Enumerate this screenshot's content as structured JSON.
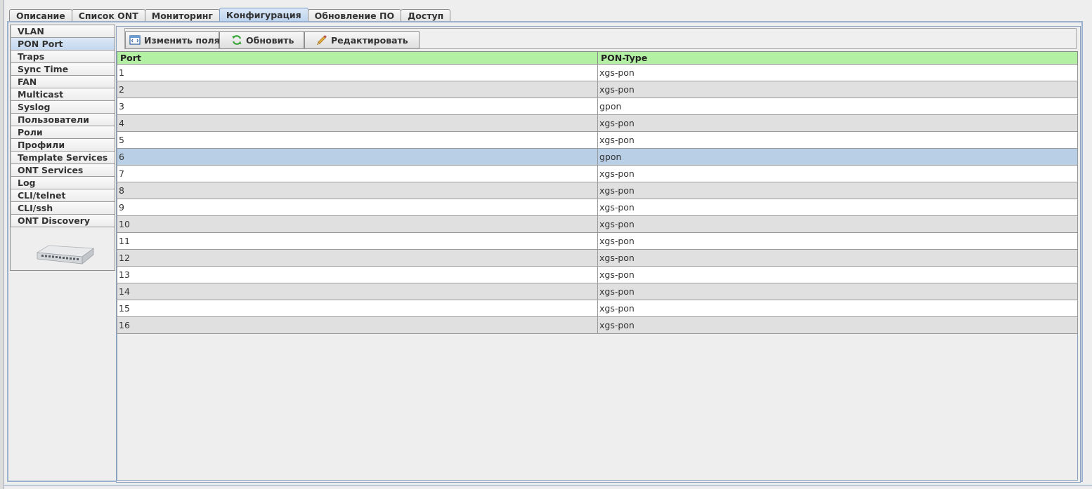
{
  "tabs": [
    {
      "label": "Описание",
      "active": false
    },
    {
      "label": "Список ONT",
      "active": false
    },
    {
      "label": "Мониторинг",
      "active": false
    },
    {
      "label": "Конфигурация",
      "active": true
    },
    {
      "label": "Обновление ПО",
      "active": false
    },
    {
      "label": "Доступ",
      "active": false
    }
  ],
  "sidebar": {
    "items": [
      {
        "label": "VLAN",
        "active": false
      },
      {
        "label": "PON Port",
        "active": true
      },
      {
        "label": "Traps",
        "active": false
      },
      {
        "label": "Sync Time",
        "active": false
      },
      {
        "label": "FAN",
        "active": false
      },
      {
        "label": "Multicast",
        "active": false
      },
      {
        "label": "Syslog",
        "active": false
      },
      {
        "label": "Пользователи",
        "active": false
      },
      {
        "label": "Роли",
        "active": false
      },
      {
        "label": "Профили",
        "active": false
      },
      {
        "label": "Template Services",
        "active": false
      },
      {
        "label": "ONT Services",
        "active": false
      },
      {
        "label": "Log",
        "active": false
      },
      {
        "label": "CLI/telnet",
        "active": false
      },
      {
        "label": "CLI/ssh",
        "active": false
      },
      {
        "label": "ONT Discovery",
        "active": false
      }
    ]
  },
  "toolbar": {
    "change_fields_label": "Изменить поля",
    "refresh_label": "Обновить",
    "edit_label": "Редактировать"
  },
  "table": {
    "headers": {
      "port": "Port",
      "pon_type": "PON-Type"
    },
    "rows": [
      {
        "port": "1",
        "pon_type": "xgs-pon",
        "selected": false
      },
      {
        "port": "2",
        "pon_type": "xgs-pon",
        "selected": false
      },
      {
        "port": "3",
        "pon_type": "gpon",
        "selected": false
      },
      {
        "port": "4",
        "pon_type": "xgs-pon",
        "selected": false
      },
      {
        "port": "5",
        "pon_type": "xgs-pon",
        "selected": false
      },
      {
        "port": "6",
        "pon_type": "gpon",
        "selected": true
      },
      {
        "port": "7",
        "pon_type": "xgs-pon",
        "selected": false
      },
      {
        "port": "8",
        "pon_type": "xgs-pon",
        "selected": false
      },
      {
        "port": "9",
        "pon_type": "xgs-pon",
        "selected": false
      },
      {
        "port": "10",
        "pon_type": "xgs-pon",
        "selected": false
      },
      {
        "port": "11",
        "pon_type": "xgs-pon",
        "selected": false
      },
      {
        "port": "12",
        "pon_type": "xgs-pon",
        "selected": false
      },
      {
        "port": "13",
        "pon_type": "xgs-pon",
        "selected": false
      },
      {
        "port": "14",
        "pon_type": "xgs-pon",
        "selected": false
      },
      {
        "port": "15",
        "pon_type": "xgs-pon",
        "selected": false
      },
      {
        "port": "16",
        "pon_type": "xgs-pon",
        "selected": false
      }
    ]
  },
  "colors": {
    "header_green": "#b3f0a4",
    "selected_row": "#b8cfe6",
    "active_tab": "#bcd3ee",
    "frame_blue": "#9ab0cf"
  },
  "icons": {
    "change_fields": "columns-icon",
    "refresh": "refresh-icon",
    "edit": "pencil-icon",
    "device": "olt-device-image"
  }
}
